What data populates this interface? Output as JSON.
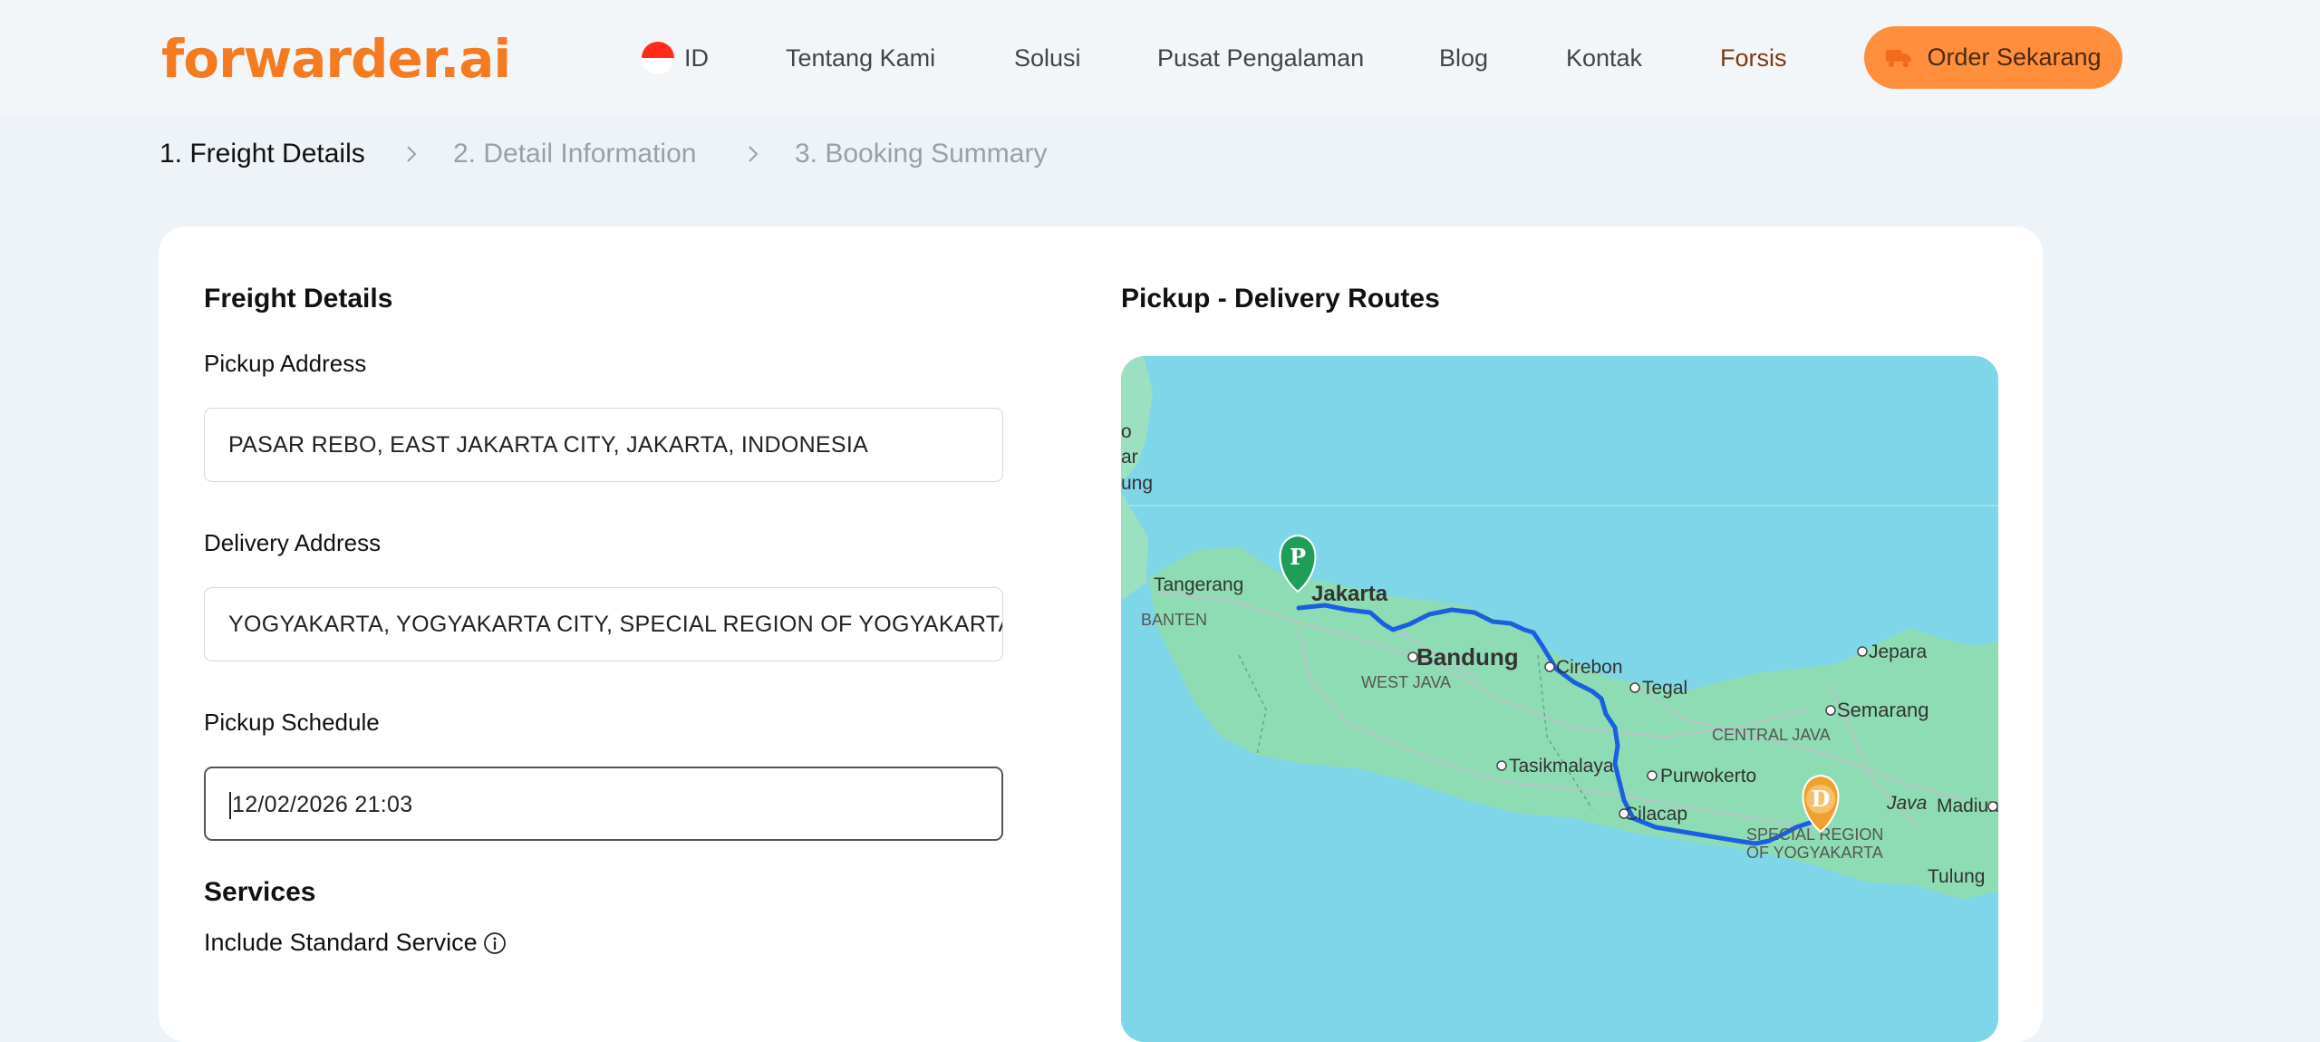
{
  "header": {
    "logo_main": "forwarder",
    "logo_tld": ".ai",
    "lang_code": "ID",
    "nav": [
      {
        "label": "Tentang Kami"
      },
      {
        "label": "Solusi"
      },
      {
        "label": "Pusat Pengalaman"
      },
      {
        "label": "Blog"
      },
      {
        "label": "Kontak"
      },
      {
        "label": "Forsis"
      }
    ],
    "cta_label": "Order Sekarang"
  },
  "steps": [
    {
      "label": "1. Freight Details",
      "state": "active"
    },
    {
      "label": "2. Detail Information",
      "state": "inactive"
    },
    {
      "label": "3. Booking Summary",
      "state": "inactive"
    }
  ],
  "form": {
    "title": "Freight Details",
    "pickup_label": "Pickup Address",
    "pickup_value": "PASAR REBO, EAST JAKARTA CITY, JAKARTA, INDONESIA",
    "delivery_label": "Delivery Address",
    "delivery_value": "YOGYAKARTA, YOGYAKARTA CITY, SPECIAL REGION OF YOGYAKARTA, INDONESIA",
    "schedule_label": "Pickup Schedule",
    "schedule_value": "12/02/2026 21:03",
    "services_title": "Services",
    "standard_service_label": "Include Standard Service"
  },
  "map": {
    "title": "Pickup - Delivery Routes",
    "pickup_marker": "P",
    "delivery_marker": "D",
    "places": {
      "tangerang": "Tangerang",
      "jakarta": "Jakarta",
      "banten": "BANTEN",
      "bandung": "Bandung",
      "west_java": "WEST JAVA",
      "cirebon": "Cirebon",
      "tegal": "Tegal",
      "jepara": "Jepara",
      "semarang": "Semarang",
      "central_java": "CENTRAL JAVA",
      "tasikmalaya": "Tasikmalaya",
      "purwokerto": "Purwokerto",
      "cilacap": "Cilacap",
      "java": "Java",
      "madiun": "Madiun",
      "special_region_1": "SPECIAL REGION",
      "special_region_2": "OF YOGYAKARTA",
      "tulung": "Tulung",
      "edge_1": "o",
      "edge_2": "ar",
      "edge_3": "ung"
    },
    "colors": {
      "water": "#7fd6e8",
      "land": "#8edcb4",
      "route": "#1a5fe0",
      "pickup_pin": "#1f9e5a",
      "delivery_pin": "#f0a030"
    }
  },
  "colors": {
    "brand": "#f47b20",
    "cta": "#ff8f3c",
    "page_bg": "#eef3f8"
  }
}
